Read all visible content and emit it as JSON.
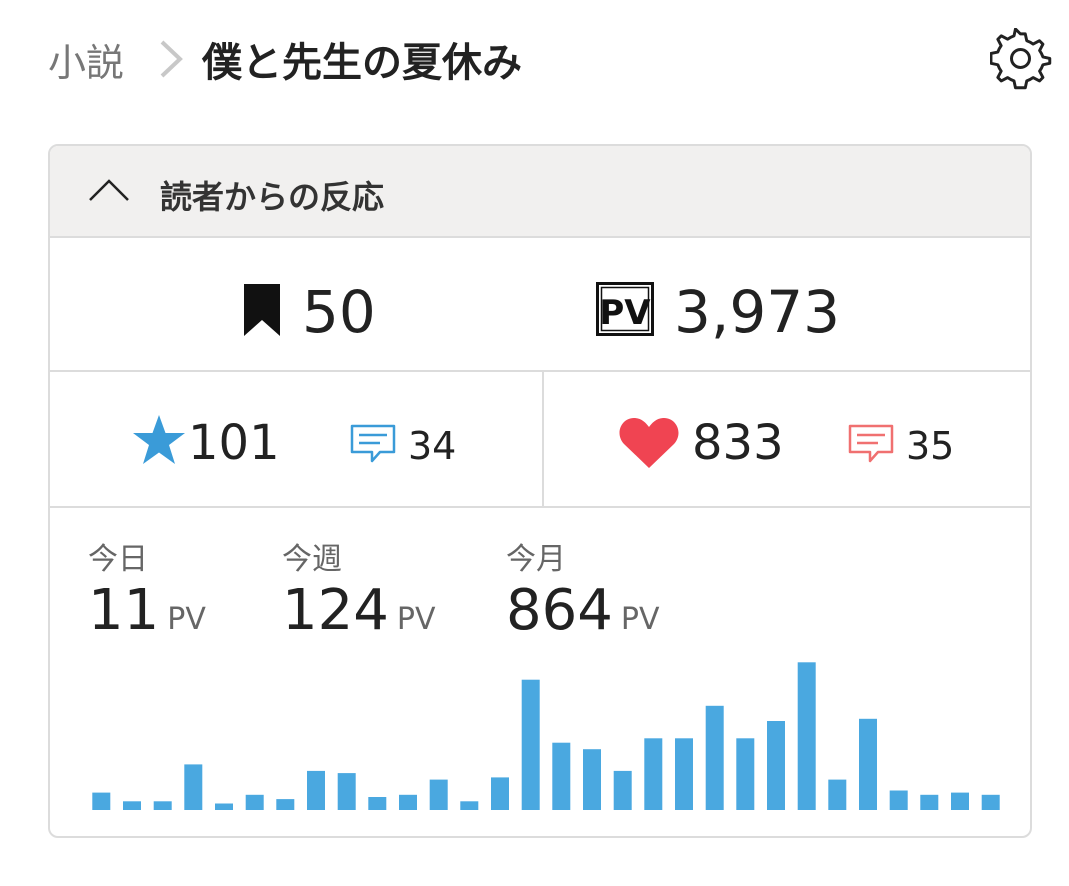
{
  "breadcrumb": {
    "parent": "小説",
    "title": "僕と先生の夏休み"
  },
  "icons": {
    "settings": "gear-icon",
    "collapse": "chevron-up-icon",
    "bookmark": "bookmark-icon",
    "pv": "pv-icon",
    "star": "star-icon",
    "comment": "comment-icon",
    "heart": "heart-icon"
  },
  "panel": {
    "title": "読者からの反応"
  },
  "totals": {
    "bookmarks": "50",
    "page_views": "3,973"
  },
  "pv_badge": "PV",
  "reactions": {
    "stars": "101",
    "star_comments": "34",
    "hearts": "833",
    "heart_comments": "35"
  },
  "colors": {
    "blue": "#3a9bd8",
    "red": "#f04452",
    "chart_bar": "#4aa8e0"
  },
  "stats": [
    {
      "label": "今日",
      "value": "11",
      "unit": "PV"
    },
    {
      "label": "今週",
      "value": "124",
      "unit": "PV"
    },
    {
      "label": "今月",
      "value": "864",
      "unit": "PV"
    }
  ],
  "chart_data": {
    "type": "bar",
    "values": [
      8,
      4,
      4,
      21,
      3,
      7,
      5,
      18,
      17,
      6,
      7,
      14,
      4,
      15,
      60,
      31,
      28,
      18,
      33,
      33,
      48,
      33,
      41,
      68,
      14,
      42,
      9,
      7,
      8,
      7
    ],
    "ylim": [
      0,
      70
    ]
  }
}
